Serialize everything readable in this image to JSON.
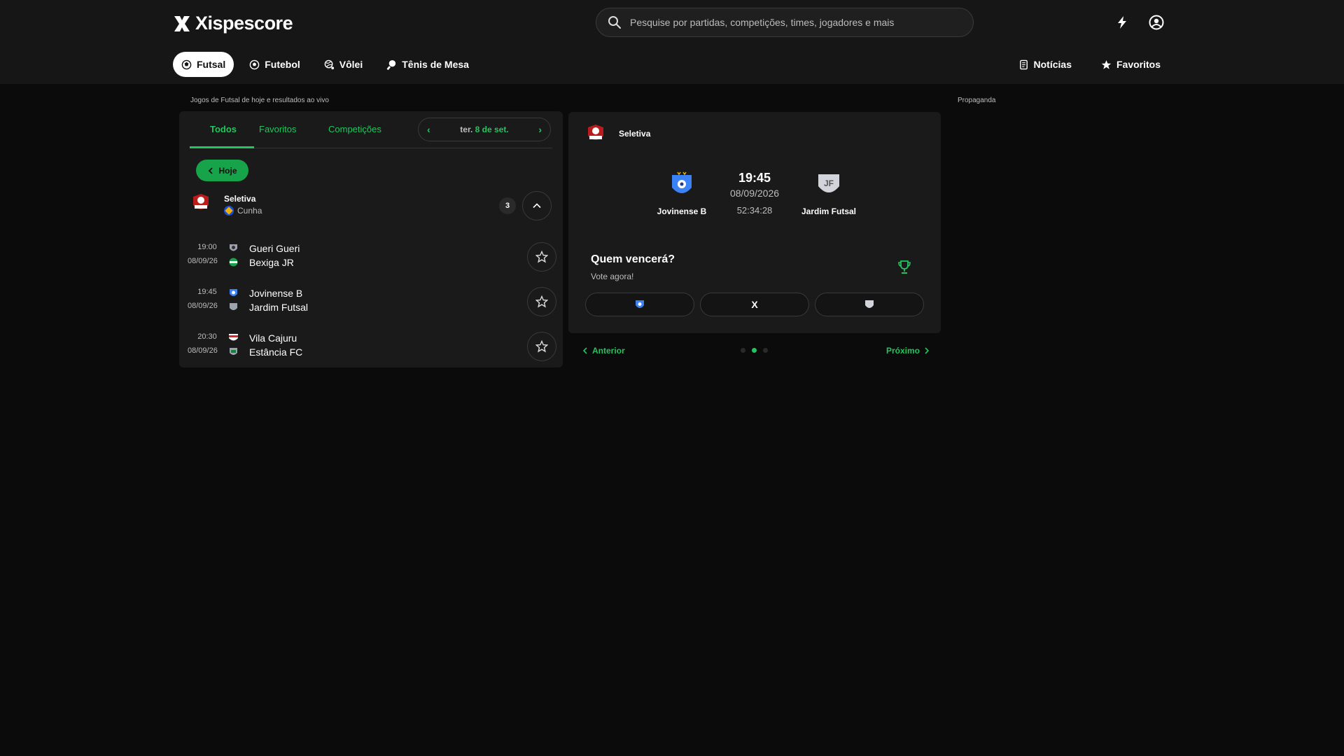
{
  "brand": {
    "name": "Xispescore"
  },
  "search": {
    "placeholder": "Pesquise por partidas, competições, times, jogadores e mais"
  },
  "nav": {
    "sports": [
      {
        "label": "Futsal",
        "active": true,
        "icon": "futsal-icon"
      },
      {
        "label": "Futebol",
        "active": false,
        "icon": "soccer-ball-icon"
      },
      {
        "label": "Vôlei",
        "active": false,
        "icon": "volleyball-icon"
      },
      {
        "label": "Tênis de Mesa",
        "active": false,
        "icon": "table-tennis-icon"
      }
    ],
    "right": [
      {
        "label": "Notícias",
        "icon": "news-icon"
      },
      {
        "label": "Favoritos",
        "icon": "star-icon"
      }
    ]
  },
  "page": {
    "subtitle": "Jogos de Futsal de hoje e resultados ao vivo",
    "ad_label": "Propaganda"
  },
  "list": {
    "tabs": [
      "Todos",
      "Favoritos",
      "Competições"
    ],
    "active_tab": "Todos",
    "date": {
      "weekday": "ter.",
      "day": "8 de set."
    },
    "today_button": "Hoje",
    "league": {
      "name": "Seletiva",
      "country": "Cunha",
      "count": "3"
    },
    "matches": [
      {
        "time": "19:00",
        "date": "08/09/26",
        "home": "Gueri Gueri",
        "away": "Bexiga JR"
      },
      {
        "time": "19:45",
        "date": "08/09/26",
        "home": "Jovinense B",
        "away": "Jardim Futsal"
      },
      {
        "time": "20:30",
        "date": "08/09/26",
        "home": "Vila Cajuru",
        "away": "Estância FC"
      }
    ]
  },
  "featured": {
    "league": "Seletiva",
    "home": "Jovinense B",
    "away": "Jardim Futsal",
    "away_crest_text": "JF",
    "time": "19:45",
    "date": "08/09/2026",
    "countdown": "52:34:28",
    "vote_title": "Quem vencerá?",
    "vote_subtitle": "Vote agora!",
    "draw_label": "X"
  },
  "pager": {
    "prev": "Anterior",
    "next": "Próximo",
    "pages": 3,
    "current": 2
  },
  "colors": {
    "accent": "#22c55e",
    "bg": "#0b0b0b",
    "panel": "#1a1a1a",
    "header": "#161616"
  }
}
